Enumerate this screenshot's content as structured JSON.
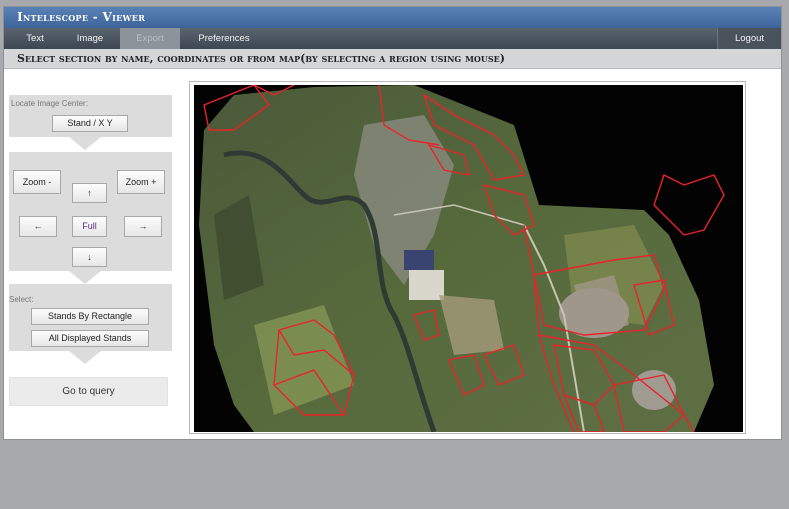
{
  "app": {
    "title": "Intelescope - Viewer"
  },
  "nav": {
    "text": "Text",
    "image": "Image",
    "export": "Export",
    "preferences": "Preferences",
    "logout": "Logout"
  },
  "header": {
    "title": "Select section by name, coordinates or from map(by selecting a region using mouse)"
  },
  "locate": {
    "label": "Locate Image Center:",
    "stand_xy": "Stand / X Y"
  },
  "zoom": {
    "zoom_out": "Zoom -",
    "zoom_in": "Zoom +",
    "up": "↑",
    "down": "↓",
    "left": "←",
    "right": "→",
    "full": "Full"
  },
  "select": {
    "label": "Select:",
    "by_rectangle": "Stands By Rectangle",
    "all_displayed": "All Displayed Stands"
  },
  "query": {
    "go": "Go to query"
  },
  "colors": {
    "titlebar": "#3f6aa0",
    "navbar": "#4a545e",
    "stand_outline": "#e8232b",
    "panel": "#dcdcdc"
  }
}
